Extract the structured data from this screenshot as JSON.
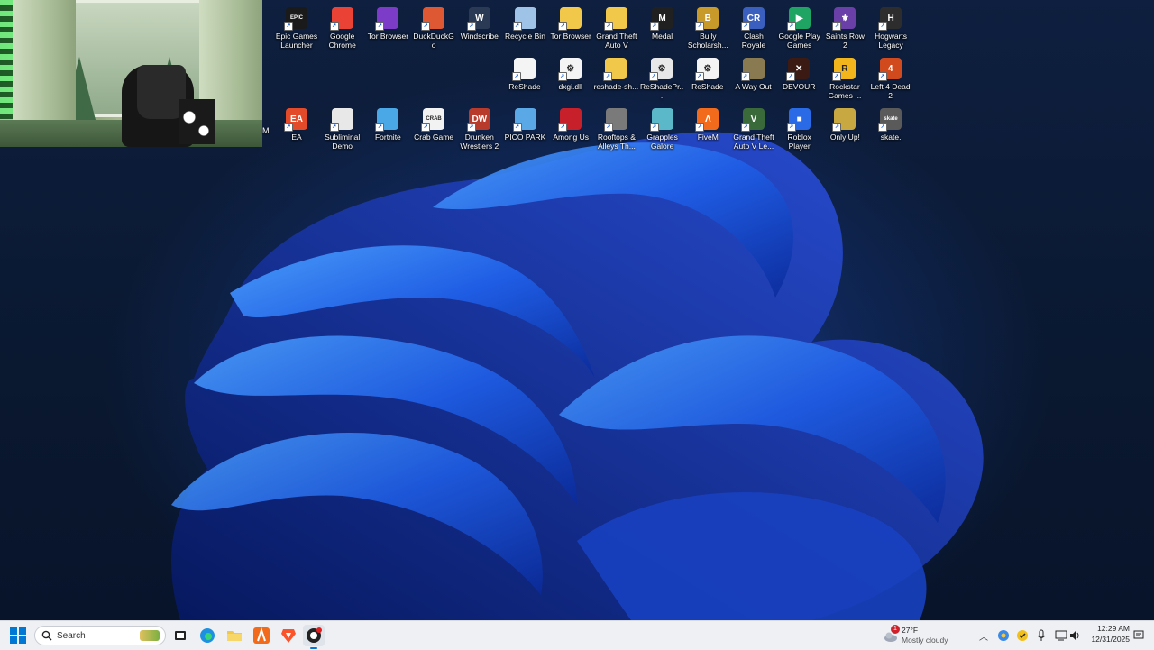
{
  "desktop": {
    "stray_letter": "M",
    "icons": [
      {
        "id": "epic",
        "label": "Epic Games Launcher",
        "color": "#1a1a1a",
        "glyph": "EPIC"
      },
      {
        "id": "chrome",
        "label": "Google Chrome",
        "color": "#ea4335",
        "glyph": ""
      },
      {
        "id": "tor1",
        "label": "Tor Browser",
        "color": "#7d3cc8",
        "glyph": ""
      },
      {
        "id": "ddg",
        "label": "DuckDuckGo",
        "color": "#de5833",
        "glyph": ""
      },
      {
        "id": "windscribe",
        "label": "Windscribe",
        "color": "#2a3a55",
        "glyph": "W"
      },
      {
        "id": "recycle",
        "label": "Recycle Bin",
        "color": "#9fc3e6",
        "glyph": ""
      },
      {
        "id": "tor2",
        "label": "Tor Browser",
        "color": "#f2c84b",
        "glyph": ""
      },
      {
        "id": "gta5",
        "label": "Grand Theft Auto V",
        "color": "#f2c84b",
        "glyph": ""
      },
      {
        "id": "medal",
        "label": "Medal",
        "color": "#202020",
        "glyph": "M"
      },
      {
        "id": "bully",
        "label": "Bully Scholarsh...",
        "color": "#c89a2a",
        "glyph": "B"
      },
      {
        "id": "clash",
        "label": "Clash Royale",
        "color": "#3a5fbf",
        "glyph": "CR"
      },
      {
        "id": "gpg",
        "label": "Google Play Games",
        "color": "#1fa463",
        "glyph": "▶"
      },
      {
        "id": "saints",
        "label": "Saints Row 2",
        "color": "#6a3fa8",
        "glyph": "⚜"
      },
      {
        "id": "hogwarts",
        "label": "Hogwarts Legacy",
        "color": "#2d2d2d",
        "glyph": "H"
      },
      {
        "id": "reshade1",
        "label": "ReShade",
        "color": "#f4f4f4",
        "glyph": ""
      },
      {
        "id": "dxgi",
        "label": "dxgi.dll",
        "color": "#f4f4f4",
        "glyph": "⚙"
      },
      {
        "id": "reshadesh",
        "label": "reshade-sh...",
        "color": "#f2c84b",
        "glyph": ""
      },
      {
        "id": "reshadepr",
        "label": "ReShadePr...",
        "color": "#e8e8e8",
        "glyph": "⚙"
      },
      {
        "id": "reshade2",
        "label": "ReShade",
        "color": "#f4f4f4",
        "glyph": "⚙"
      },
      {
        "id": "awayout",
        "label": "A Way Out",
        "color": "#8a7a52",
        "glyph": ""
      },
      {
        "id": "devour",
        "label": "DEVOUR",
        "color": "#3a1a12",
        "glyph": "✕"
      },
      {
        "id": "rockstar",
        "label": "Rockstar Games ...",
        "color": "#f2b61c",
        "glyph": "R"
      },
      {
        "id": "l4d2",
        "label": "Left 4 Dead 2",
        "color": "#d14a1e",
        "glyph": "4"
      },
      {
        "id": "ea",
        "label": "EA",
        "color": "#e24a2a",
        "glyph": "EA"
      },
      {
        "id": "subliminal",
        "label": "Subliminal Demo",
        "color": "#e8e8e8",
        "glyph": ""
      },
      {
        "id": "fortnite",
        "label": "Fortnite",
        "color": "#4aa8e6",
        "glyph": ""
      },
      {
        "id": "crab",
        "label": "Crab Game",
        "color": "#f2f2f2",
        "glyph": "CRAB"
      },
      {
        "id": "drunken",
        "label": "Drunken Wrestlers 2",
        "color": "#b83a2a",
        "glyph": "DW"
      },
      {
        "id": "pico",
        "label": "PICO PARK",
        "color": "#5aa8e6",
        "glyph": ""
      },
      {
        "id": "amongus",
        "label": "Among Us",
        "color": "#c8202a",
        "glyph": ""
      },
      {
        "id": "rooftops",
        "label": "Rooftops & Alleys Th...",
        "color": "#7a7a7a",
        "glyph": ""
      },
      {
        "id": "grapples",
        "label": "Grapples Galore",
        "color": "#5ab8c8",
        "glyph": ""
      },
      {
        "id": "fivem",
        "label": "FiveM",
        "color": "#f26b1c",
        "glyph": "Λ"
      },
      {
        "id": "gta5le",
        "label": "Grand Theft Auto V Le...",
        "color": "#3a6a3a",
        "glyph": "V"
      },
      {
        "id": "roblox",
        "label": "Roblox Player",
        "color": "#2a6ae6",
        "glyph": "■"
      },
      {
        "id": "onlyup",
        "label": "Only Up!",
        "color": "#c8a840",
        "glyph": ""
      },
      {
        "id": "skate",
        "label": "skate.",
        "color": "#5a5a5a",
        "glyph": "skate"
      }
    ]
  },
  "taskbar": {
    "search_placeholder": "Search",
    "weather_temp": "27°F",
    "weather_desc": "Mostly cloudy",
    "weather_badge": "1",
    "time": "12:29 AM",
    "date": "12/31/2025",
    "colors": {
      "start": "#0078d4",
      "edge": "#1e90e0",
      "files": "#f2c84b",
      "brave": "#fb542b"
    }
  }
}
